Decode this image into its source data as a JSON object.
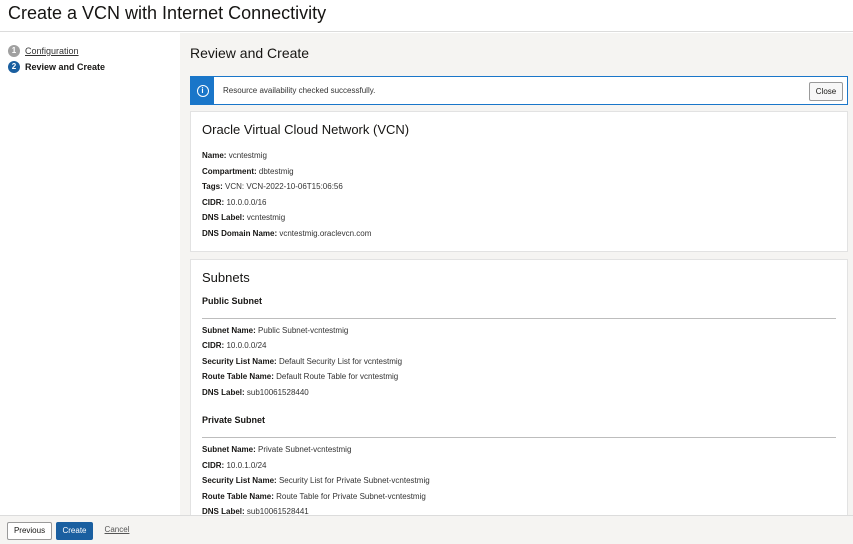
{
  "header": {
    "title": "Create a VCN with Internet Connectivity"
  },
  "steps": [
    {
      "number": "1",
      "label": "Configuration",
      "state": "completed"
    },
    {
      "number": "2",
      "label": "Review and Create",
      "state": "current"
    }
  ],
  "main": {
    "title": "Review and Create",
    "alert": {
      "icon": "info-icon",
      "message": "Resource availability checked successfully.",
      "close_label": "Close"
    },
    "vcn": {
      "title": "Oracle Virtual Cloud Network (VCN)",
      "fields": [
        {
          "label": "Name:",
          "value": "vcntestmig"
        },
        {
          "label": "Compartment:",
          "value": "dbtestmig"
        },
        {
          "label": "Tags:",
          "value": "VCN: VCN-2022-10-06T15:06:56"
        },
        {
          "label": "CIDR:",
          "value": "10.0.0.0/16"
        },
        {
          "label": "DNS Label:",
          "value": "vcntestmig"
        },
        {
          "label": "DNS Domain Name:",
          "value": "vcntestmig.oraclevcn.com"
        }
      ]
    },
    "subnets": {
      "title": "Subnets",
      "public": {
        "title": "Public Subnet",
        "fields": [
          {
            "label": "Subnet Name:",
            "value": "Public Subnet-vcntestmig"
          },
          {
            "label": "CIDR:",
            "value": "10.0.0.0/24"
          },
          {
            "label": "Security List Name:",
            "value": "Default Security List for vcntestmig"
          },
          {
            "label": "Route Table Name:",
            "value": "Default Route Table for vcntestmig"
          },
          {
            "label": "DNS Label:",
            "value": "sub10061528440"
          }
        ]
      },
      "private": {
        "title": "Private Subnet",
        "fields": [
          {
            "label": "Subnet Name:",
            "value": "Private Subnet-vcntestmig"
          },
          {
            "label": "CIDR:",
            "value": "10.0.1.0/24"
          },
          {
            "label": "Security List Name:",
            "value": "Security List for Private Subnet-vcntestmig"
          },
          {
            "label": "Route Table Name:",
            "value": "Route Table for Private Subnet-vcntestmig"
          },
          {
            "label": "DNS Label:",
            "value": "sub10061528441"
          }
        ]
      }
    }
  },
  "footer": {
    "previous_label": "Previous",
    "create_label": "Create",
    "cancel_label": "Cancel"
  },
  "colors": {
    "primary": "#1a5fa0",
    "info": "#1a76c9",
    "background": "#f5f4f2"
  }
}
